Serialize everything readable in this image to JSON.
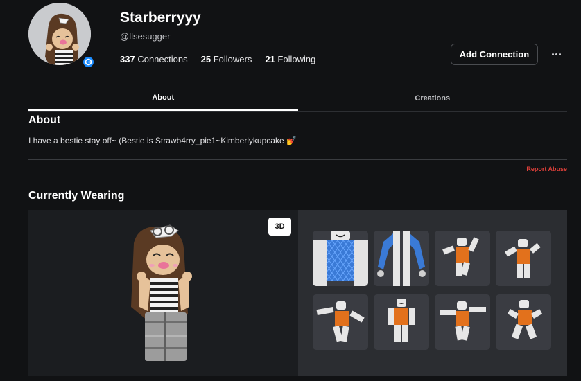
{
  "profile": {
    "display_name": "Starberryyy",
    "username": "@llsesugger",
    "stats": [
      {
        "count": "337",
        "label": "Connections"
      },
      {
        "count": "25",
        "label": "Followers"
      },
      {
        "count": "21",
        "label": "Following"
      }
    ],
    "presence_icon": "game-controller-icon"
  },
  "actions": {
    "add_connection": "Add Connection",
    "more_icon": "ellipsis-icon"
  },
  "tabs": [
    {
      "label": "About",
      "active": true
    },
    {
      "label": "Creations",
      "active": false
    }
  ],
  "about": {
    "title": "About",
    "description": "I have a bestie stay off~ (Bestie is Strawb4rry_pie1~Kimberlykupcake 💅",
    "report_label": "Report Abuse"
  },
  "wearing": {
    "title": "Currently Wearing",
    "view_toggle": "3D",
    "items": [
      {
        "name": "striped-shirt-item"
      },
      {
        "name": "blue-sleeves-item"
      },
      {
        "name": "animation-pose-1"
      },
      {
        "name": "animation-pose-2"
      },
      {
        "name": "animation-pose-3"
      },
      {
        "name": "animation-pose-4"
      },
      {
        "name": "animation-pose-5"
      },
      {
        "name": "animation-pose-6"
      }
    ]
  },
  "colors": {
    "background": "#111214",
    "accent_blue": "#1b8cff",
    "report_red": "#e0403a",
    "avatar_orange": "#e2711c"
  }
}
